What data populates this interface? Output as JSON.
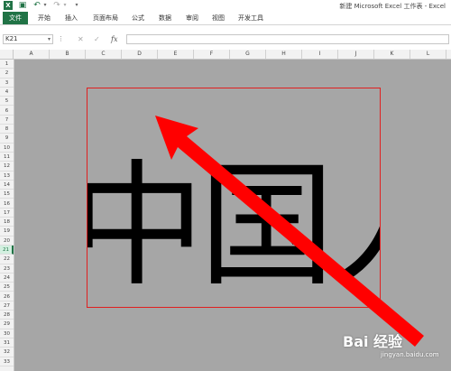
{
  "window": {
    "title": "新建 Microsoft Excel 工作表 - Excel",
    "app_icon": "X"
  },
  "quick_access": {
    "icons": [
      "save-icon",
      "undo-icon",
      "redo-icon",
      "customize-icon"
    ]
  },
  "ribbon": {
    "tabs": [
      "文件",
      "开始",
      "插入",
      "页面布局",
      "公式",
      "数据",
      "审阅",
      "视图",
      "开发工具"
    ],
    "file_color": "#217346"
  },
  "formula_bar": {
    "name_box": "K21",
    "cancel": "✕",
    "enter": "✓",
    "fx": "fx",
    "content": ""
  },
  "grid": {
    "columns": [
      "A",
      "B",
      "C",
      "D",
      "E",
      "F",
      "G",
      "H",
      "I",
      "J",
      "K",
      "L"
    ],
    "rows": [
      "1",
      "2",
      "3",
      "4",
      "5",
      "6",
      "7",
      "8",
      "9",
      "10",
      "11",
      "12",
      "13",
      "14",
      "15",
      "16",
      "17",
      "18",
      "19",
      "20",
      "21",
      "22",
      "23",
      "24",
      "25",
      "26",
      "27",
      "28",
      "29",
      "30",
      "31",
      "32",
      "33"
    ],
    "active_row": "21",
    "background_color": "#a6a6a6"
  },
  "picture": {
    "text": "中国人",
    "border_color": "#e02020"
  },
  "annotation": {
    "arrow_color": "#ff0000"
  },
  "watermark": {
    "logo": "Bai 经验",
    "url": "jingyan.baidu.com"
  }
}
